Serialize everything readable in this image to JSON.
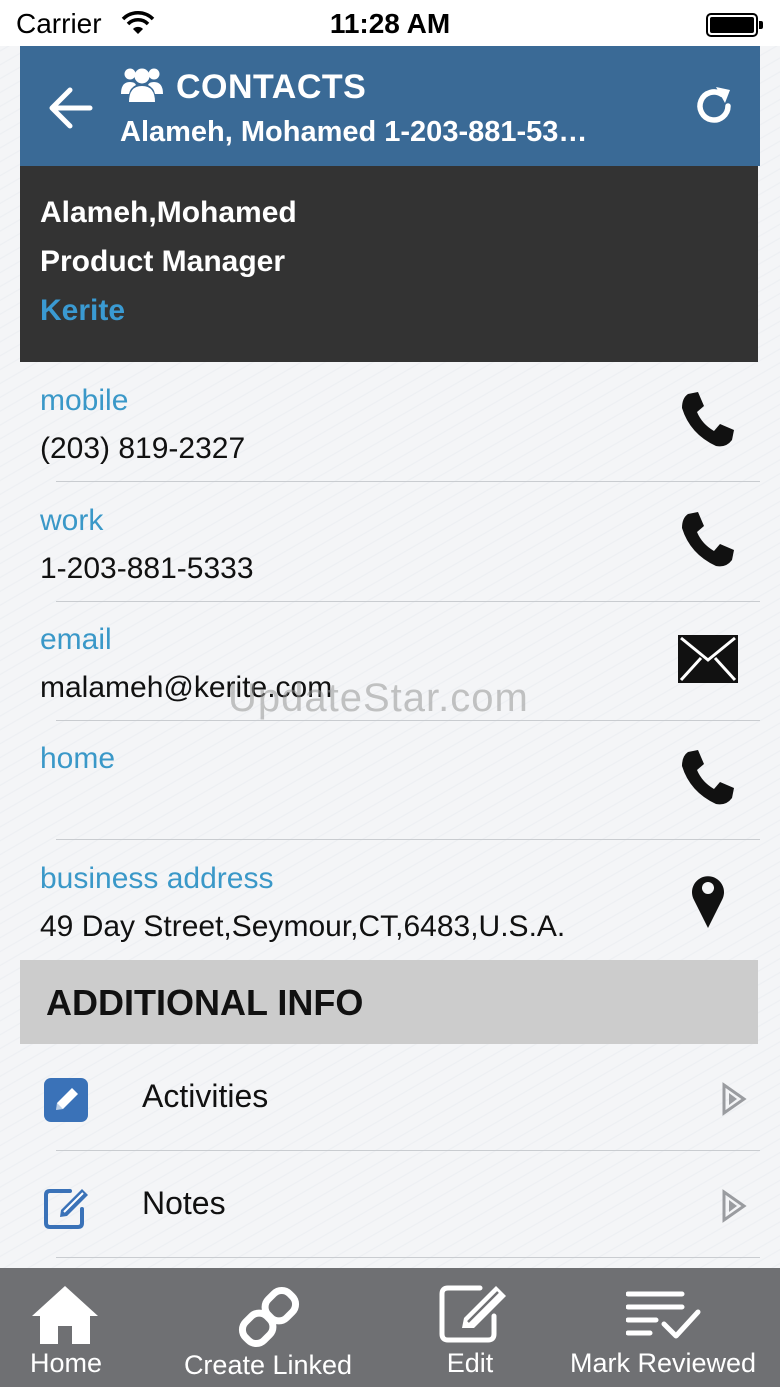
{
  "status_bar": {
    "carrier": "Carrier",
    "time": "11:28 AM"
  },
  "header": {
    "title": "CONTACTS",
    "subtitle": "Alameh, Mohamed 1-203-881-5333"
  },
  "contact": {
    "name": "Alameh,Mohamed",
    "job_title": "Product Manager",
    "company": "Kerite"
  },
  "details": [
    {
      "label": "mobile",
      "value": "(203) 819-2327",
      "action_icon": "phone-icon"
    },
    {
      "label": "work",
      "value": "1-203-881-5333",
      "action_icon": "phone-icon"
    },
    {
      "label": "email",
      "value": "malameh@kerite.com",
      "action_icon": "mail-icon"
    },
    {
      "label": "home",
      "value": "",
      "action_icon": "phone-icon"
    },
    {
      "label": "business address",
      "value": "49 Day Street,Seymour,CT,6483,U.S.A.",
      "action_icon": "map-pin-icon"
    }
  ],
  "watermark": "UpdateStar.com",
  "additional_info": {
    "title": "ADDITIONAL INFO",
    "items": [
      {
        "label": "Activities",
        "icon": "pencil-square-icon"
      },
      {
        "label": "Notes",
        "icon": "edit-icon"
      }
    ]
  },
  "toolbar": {
    "home": "Home",
    "create_linked": "Create Linked",
    "edit": "Edit",
    "mark_reviewed": "Mark Reviewed"
  },
  "colors": {
    "header_bg": "#3a6a96",
    "card_bg": "#333333",
    "accent": "#3a98c8",
    "toolbar_bg": "#6f7073",
    "section_bg": "#cccccc"
  }
}
